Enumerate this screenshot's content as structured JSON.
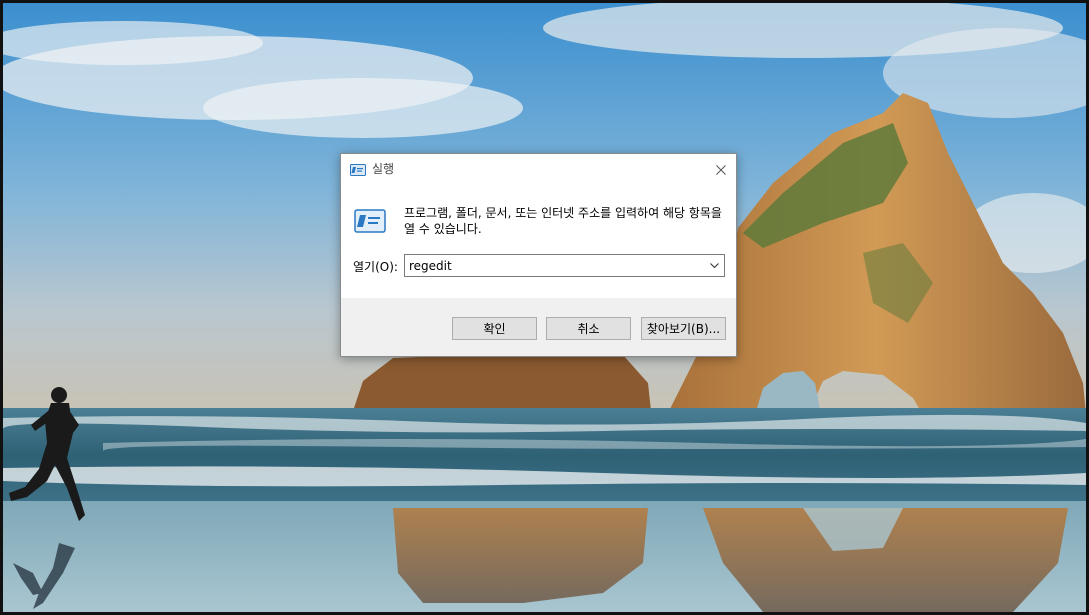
{
  "dialog": {
    "title": "실행",
    "description": "프로그램, 폴더, 문서, 또는 인터넷 주소를 입력하여 해당 항목을 열 수 있습니다.",
    "open_label": "열기(O):",
    "open_value": "regedit",
    "ok_label": "확인",
    "cancel_label": "취소",
    "browse_label": "찾아보기(B)..."
  },
  "icons": {
    "title": "run-icon",
    "big": "run-icon",
    "close": "close-icon",
    "dropdown": "chevron-down-icon"
  },
  "colors": {
    "dialog_bg": "#f0f0f0",
    "content_bg": "#ffffff",
    "button_bg": "#e1e1e1",
    "button_border": "#adadad",
    "run_icon_blue": "#2b79c2"
  }
}
